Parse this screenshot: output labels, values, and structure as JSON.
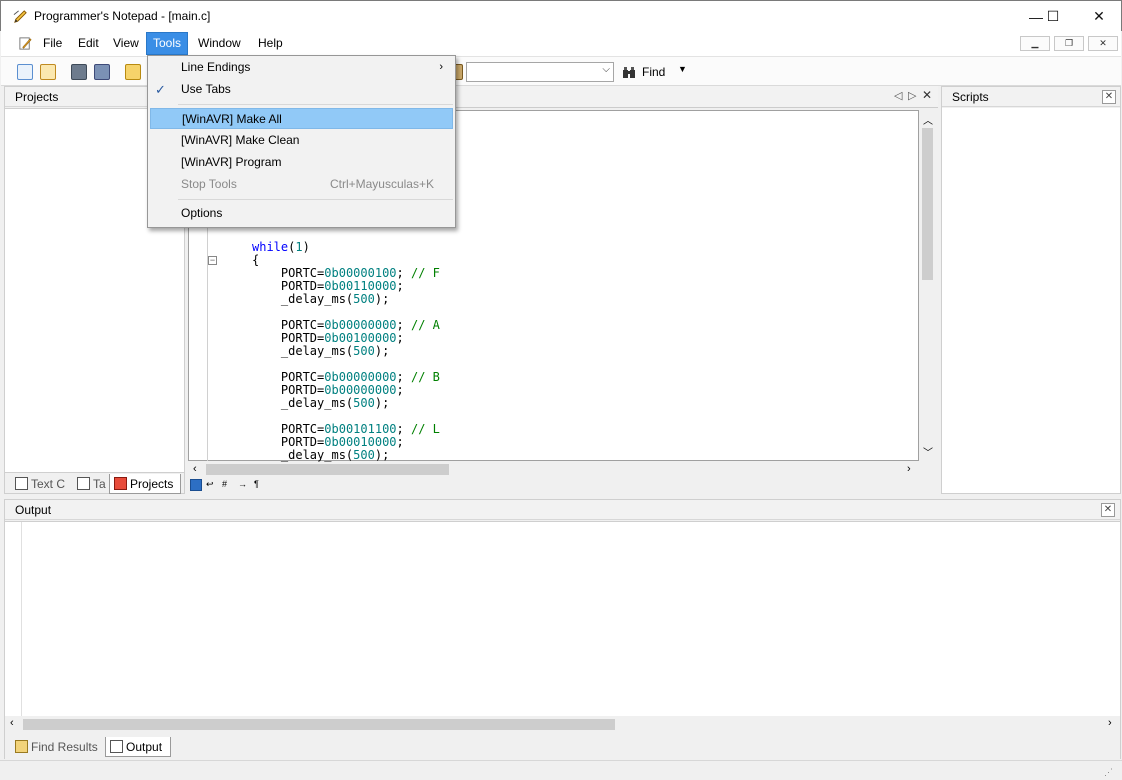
{
  "window": {
    "title": "Programmer's Notepad - [main.c]",
    "minimize": "—",
    "maximize": "☐",
    "close": "✕"
  },
  "menubar": {
    "items": [
      "File",
      "Edit",
      "View",
      "Tools",
      "Window",
      "Help"
    ],
    "active": "Tools"
  },
  "toolbar": {
    "find_label": "Find",
    "find_combo_value": ""
  },
  "tools_menu": {
    "line_endings": "Line Endings",
    "use_tabs": "Use Tabs",
    "use_tabs_checked": true,
    "make_all": "[WinAVR] Make All",
    "make_clean": "[WinAVR] Make Clean",
    "program": "[WinAVR] Program",
    "stop_tools": "Stop Tools",
    "stop_tools_shortcut": "Ctrl+Mayusculas+K",
    "options": "Options"
  },
  "panes": {
    "projects": "Projects",
    "scripts": "Scripts",
    "output": "Output"
  },
  "left_tabs": [
    "Text C",
    "Ta",
    "Projects"
  ],
  "bottom_tabs": [
    "Find Results",
    "Output"
  ],
  "editor": {
    "lines": [
      {
        "indent": "",
        "kw": "while",
        "rest": "(",
        "num": "1",
        "tail": ")",
        "comment": ""
      },
      {
        "indent": "",
        "kw": "",
        "rest": "{",
        "num": "",
        "tail": "",
        "comment": ""
      },
      {
        "indent": "    ",
        "kw": "",
        "rest": "PORTC=",
        "num": "0b00000100",
        "tail": "; ",
        "comment": "// F"
      },
      {
        "indent": "    ",
        "kw": "",
        "rest": "PORTD=",
        "num": "0b00110000",
        "tail": ";",
        "comment": ""
      },
      {
        "indent": "    ",
        "kw": "",
        "rest": "_delay_ms(",
        "num": "500",
        "tail": ");",
        "comment": ""
      },
      {
        "indent": "",
        "kw": "",
        "rest": "",
        "num": "",
        "tail": "",
        "comment": ""
      },
      {
        "indent": "    ",
        "kw": "",
        "rest": "PORTC=",
        "num": "0b00000000",
        "tail": "; ",
        "comment": "// A"
      },
      {
        "indent": "    ",
        "kw": "",
        "rest": "PORTD=",
        "num": "0b00100000",
        "tail": ";",
        "comment": ""
      },
      {
        "indent": "    ",
        "kw": "",
        "rest": "_delay_ms(",
        "num": "500",
        "tail": ");",
        "comment": ""
      },
      {
        "indent": "",
        "kw": "",
        "rest": "",
        "num": "",
        "tail": "",
        "comment": ""
      },
      {
        "indent": "    ",
        "kw": "",
        "rest": "PORTC=",
        "num": "0b00000000",
        "tail": "; ",
        "comment": "// B"
      },
      {
        "indent": "    ",
        "kw": "",
        "rest": "PORTD=",
        "num": "0b00000000",
        "tail": ";",
        "comment": ""
      },
      {
        "indent": "    ",
        "kw": "",
        "rest": "_delay_ms(",
        "num": "500",
        "tail": ");",
        "comment": ""
      },
      {
        "indent": "",
        "kw": "",
        "rest": "",
        "num": "",
        "tail": "",
        "comment": ""
      },
      {
        "indent": "    ",
        "kw": "",
        "rest": "PORTC=",
        "num": "0b00101100",
        "tail": "; ",
        "comment": "// L"
      },
      {
        "indent": "    ",
        "kw": "",
        "rest": "PORTD=",
        "num": "0b00010000",
        "tail": ";",
        "comment": ""
      },
      {
        "indent": "    ",
        "kw": "",
        "rest": "_delay_ms(",
        "num": "500",
        "tail": ");",
        "comment": ""
      }
    ]
  },
  "colors": {
    "menu_active": "#3a8ee6",
    "menu_highlight": "#91c9f7",
    "keyword": "#0000ff",
    "number": "#008080",
    "comment": "#008000"
  }
}
